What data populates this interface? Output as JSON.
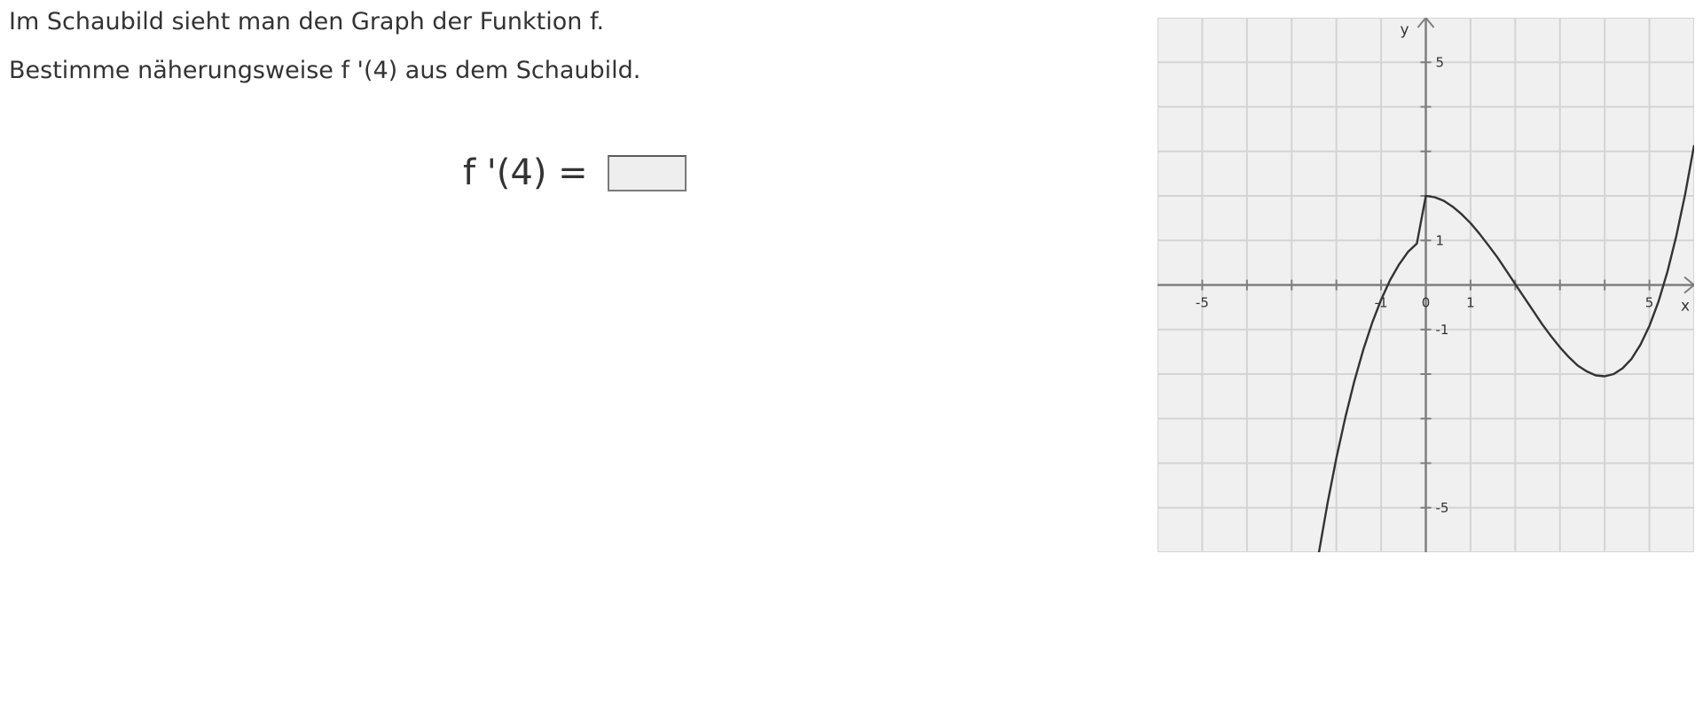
{
  "task": {
    "line1": "Im Schaubild sieht man den Graph der Funktion f.",
    "line2": "Bestimme näherungsweise f '(4) aus dem Schaubild."
  },
  "answer": {
    "label": "f '(4) =",
    "value": ""
  },
  "colors": {
    "plot_background": "#f0f0f0",
    "grid": "#d4d4d4",
    "axis": "#7f7f7f",
    "curve": "#333333"
  },
  "chart_data": {
    "type": "line",
    "title": "",
    "xlabel": "x",
    "ylabel": "y",
    "xlim": [
      -6,
      6
    ],
    "ylim": [
      -6,
      6
    ],
    "grid": true,
    "x_tick_labels": [
      {
        "value": -5,
        "text": "-5"
      },
      {
        "value": -1,
        "text": "-1"
      },
      {
        "value": 0,
        "text": "0"
      },
      {
        "value": 1,
        "text": "1"
      },
      {
        "value": 5,
        "text": "5"
      }
    ],
    "y_tick_labels": [
      {
        "value": 5,
        "text": "5"
      },
      {
        "value": 1,
        "text": "1"
      },
      {
        "value": -1,
        "text": "-1"
      },
      {
        "value": -5,
        "text": "-5"
      }
    ],
    "series": [
      {
        "x": [
          -2.4,
          -2.2,
          -2.0,
          -1.8,
          -1.6,
          -1.4,
          -1.2,
          -1.0,
          -0.8,
          -0.6,
          -0.4,
          -0.2,
          0.0,
          0.2,
          0.4,
          0.6,
          0.8,
          1.0,
          1.2,
          1.4,
          1.6,
          1.8,
          2.0,
          2.2,
          2.4,
          2.6,
          2.8,
          3.0,
          3.2,
          3.4,
          3.6,
          3.8,
          4.0,
          4.2,
          4.4,
          4.6,
          4.8,
          5.0,
          5.2,
          5.4,
          5.6,
          5.8,
          6.0
        ],
        "y": [
          -6.06,
          -4.91,
          -3.88,
          -2.97,
          -2.17,
          -1.46,
          -0.85,
          -0.33,
          0.11,
          0.46,
          0.74,
          0.93,
          2.0,
          1.97,
          1.89,
          1.76,
          1.59,
          1.39,
          1.15,
          0.89,
          0.62,
          0.32,
          0.02,
          -0.28,
          -0.58,
          -0.88,
          -1.15,
          -1.4,
          -1.62,
          -1.81,
          -1.94,
          -2.03,
          -2.05,
          -2.0,
          -1.87,
          -1.66,
          -1.34,
          -0.92,
          -0.38,
          0.29,
          1.09,
          2.04,
          3.14
        ]
      }
    ]
  }
}
